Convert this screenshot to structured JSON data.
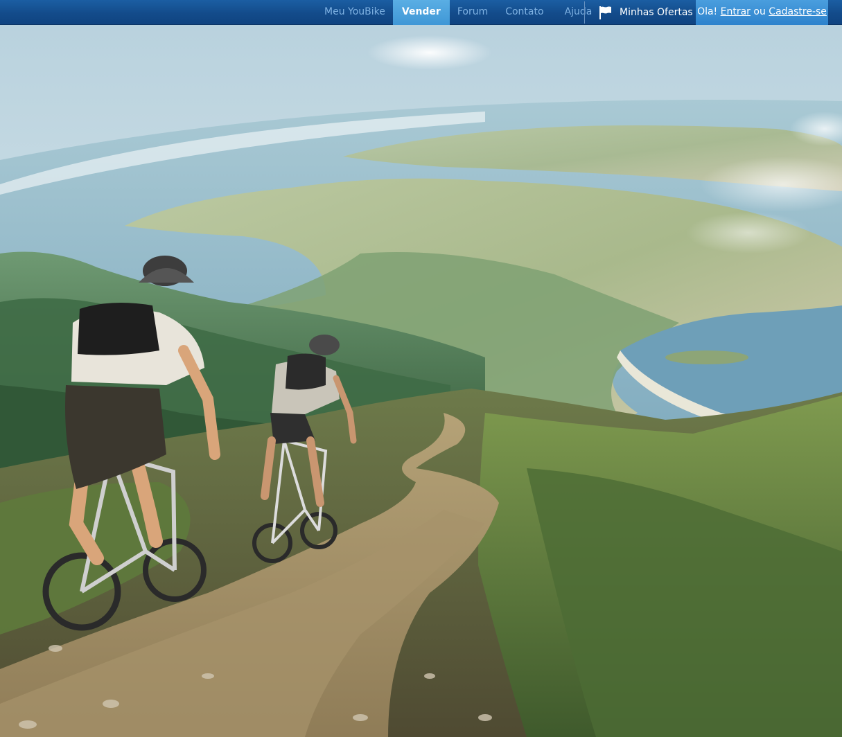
{
  "nav": {
    "items": [
      {
        "label": "Meu YouBike",
        "active": false
      },
      {
        "label": "Vender",
        "active": true
      },
      {
        "label": "Forum",
        "active": false
      },
      {
        "label": "Contato",
        "active": false
      },
      {
        "label": "Ajuda",
        "active": false
      }
    ],
    "offers_label": "Minhas Ofertas",
    "offers_icon": "flag-icon"
  },
  "login": {
    "greeting": "Ola!",
    "enter_label": "Entrar",
    "or_label": "ou",
    "signup_label": "Cadastre-se"
  },
  "colors": {
    "nav_bar": "#134b8a",
    "nav_active": "#4aa3df",
    "login_bg": "#3a8fd5"
  }
}
